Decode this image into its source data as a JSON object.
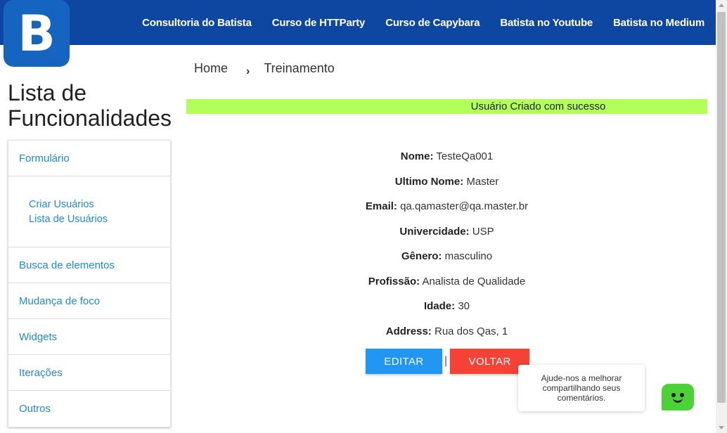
{
  "logo": {
    "letter": "B"
  },
  "nav": [
    {
      "label": "Consultoria do Batista"
    },
    {
      "label": "Curso de HTTParty"
    },
    {
      "label": "Curso de Capybara"
    },
    {
      "label": "Batista no Youtube"
    },
    {
      "label": "Batista no Medium"
    }
  ],
  "sidebar": {
    "title_line1": "Lista de",
    "title_line2": "Funcionalidades",
    "items": {
      "formulario": "Formulário",
      "criar_usuarios": "Criar Usuários",
      "lista_usuarios": "Lista de Usuários",
      "busca": "Busca de elementos",
      "foco": "Mudança de foco",
      "widgets": "Widgets",
      "iteracoes": "Iterações",
      "outros": "Outros"
    }
  },
  "breadcrumb": {
    "home": "Home",
    "chevron": "›",
    "current": "Treinamento"
  },
  "toast": {
    "message": "Usuário Criado com sucesso",
    "color": "#b2ff59"
  },
  "user": [
    {
      "label": "Nome:",
      "value": "TesteQa001"
    },
    {
      "label": "Ultimo Nome:",
      "value": "Master"
    },
    {
      "label": "Email:",
      "value": "qa.qamaster@qa.master.br"
    },
    {
      "label": "Univercidade:",
      "value": "USP"
    },
    {
      "label": "Gênero:",
      "value": "masculino"
    },
    {
      "label": "Profissão:",
      "value": "Analista de Qualidade"
    },
    {
      "label": "Idade:",
      "value": "30"
    },
    {
      "label": "Address:",
      "value": "Rua dos Qas, 1"
    }
  ],
  "actions": {
    "edit_label": "EDITAR",
    "separator": "|",
    "back_label": "VOLTAR"
  },
  "feedback": {
    "message": "Ajude-nos a melhorar compartilhando seus comentários."
  },
  "colors": {
    "header": "#0d47a1",
    "link": "#1e88e5",
    "edit": "#2196f3",
    "back": "#f44336",
    "bot": "#4cd137"
  }
}
